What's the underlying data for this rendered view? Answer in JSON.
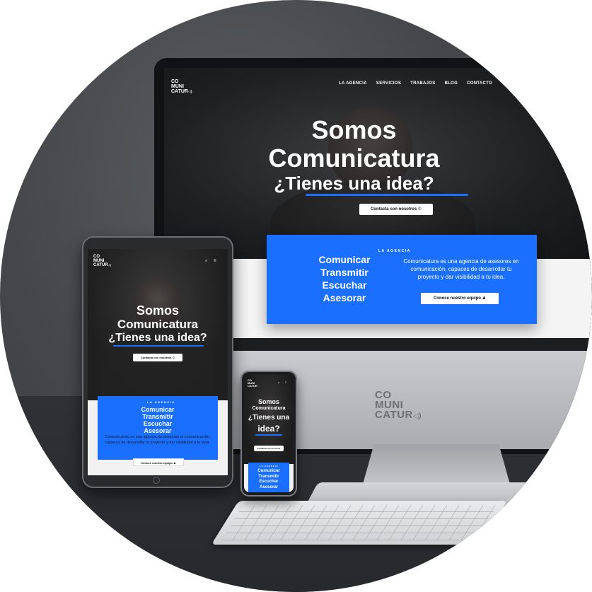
{
  "colors": {
    "accent": "#1a6fff",
    "background": "#45474b",
    "hero_dark": "#1e1f21"
  },
  "logo": {
    "line1": "CO",
    "line2": "MUNI",
    "line3": "CATUR"
  },
  "desktop": {
    "nav": [
      "LA AGENCIA",
      "SERVICIOS",
      "TRABAJOS",
      "BLOG",
      "CONTACTO"
    ],
    "hero_line1": "Somos",
    "hero_line2": "Comunicatura",
    "hero_line3": "¿Tienes una idea?",
    "cta_label": "Contacta con nosotros",
    "verbs": [
      "Comunicar",
      "Transmitir",
      "Escuchar",
      "Asesorar"
    ],
    "agency_label": "LA AGENCIA",
    "agency_desc": "Comunicatura es una agencia de asesores en comunicación, capaces de desarrollar tu proyecto y dar visibilidad a tu idea.",
    "team_button": "Conoce nuestro equipo"
  },
  "monitor_logo": {
    "line1": "CO",
    "line2": "MUNI",
    "line3": "CATUR"
  },
  "tablet": {
    "hero_line1": "Somos",
    "hero_line2": "Comunicatura",
    "hero_line3": "¿Tienes una idea?",
    "cta_label": "Contacta con nosotros",
    "agency_label": "LA AGENCIA",
    "verbs": [
      "Comunicar",
      "Transmitir",
      "Escuchar",
      "Asesorar"
    ],
    "agency_desc": "Comunicatura es una agencia de asesores en comunicación, capaces de desarrollar tu proyecto y dar visibilidad a tu idea.",
    "team_button": "Conoce nuestro equipo"
  },
  "phone": {
    "hero_line1": "Somos",
    "hero_line2": "Comunicatura",
    "hero_line3": "¿Tienes una",
    "hero_line4": "idea?",
    "cta_label": "Contacta con nosotros",
    "agency_label": "LA AGENCIA",
    "verbs": [
      "Comunicar",
      "Transmitir",
      "Escuchar",
      "Asesorar"
    ]
  },
  "icons": {
    "search": "search-icon",
    "menu": "menu-icon",
    "whatsapp": "whatsapp-icon",
    "team": "user-icon",
    "logo_mark": "megaphone-icon"
  }
}
